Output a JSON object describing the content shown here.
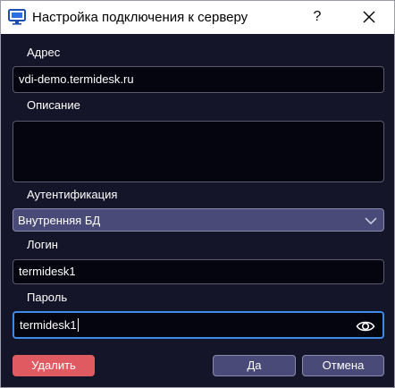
{
  "window": {
    "title": "Настройка подключения к серверу",
    "help_label": "?"
  },
  "form": {
    "address": {
      "label": "Адрес",
      "value": "vdi-demo.termidesk.ru"
    },
    "description": {
      "label": "Описание",
      "value": ""
    },
    "auth": {
      "label": "Аутентификация",
      "selected": "Внутренняя БД"
    },
    "login": {
      "label": "Логин",
      "value": "termidesk1"
    },
    "password": {
      "label": "Пароль",
      "value": "termidesk1"
    }
  },
  "buttons": {
    "delete_label": "Удалить",
    "ok_label": "Да",
    "cancel_label": "Отмена"
  },
  "colors": {
    "background": "#15152a",
    "field_bg": "#050510",
    "select_bg": "#4a4a78",
    "focus_border": "#3d8be8",
    "danger": "#e05a62"
  },
  "icons": {
    "app": "server-connection-icon",
    "close": "close-icon",
    "select_arrow": "chevron-down-icon",
    "password_toggle": "eye-icon"
  }
}
